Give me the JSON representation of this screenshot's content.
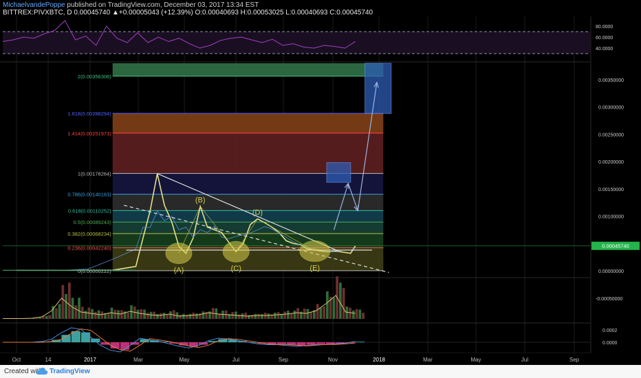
{
  "header": {
    "author": "MichaelvandePoppe",
    "published": "published on TradingView.com, December 03, 2017 13:34 EST",
    "ohlc_line": "BITTREX:PIVXBTC, D  0.00045740  ▲+0.00005043 (+12.39%)  O:0.00040693  H:0.00053025  L:0.00040693  C:0.00045740"
  },
  "footer": {
    "created_with": "Created with",
    "brand": "TradingView"
  },
  "colors": {
    "background": "#000000",
    "candle_up": "#e6e08a",
    "rsi": "#a040c0",
    "trendline": "#dddddd",
    "wave_ellipse": "#d8cc4a",
    "projection_box": "#2c5db5",
    "arrow": "#9fb4e0",
    "price_tag": "#23b54a"
  },
  "chart_data": {
    "type": "line",
    "title": "",
    "symbol": "BITTREX:PIVXBTC",
    "interval": "D",
    "x_tick_labels": [
      "Oct",
      "14",
      "2017",
      "Mar",
      "May",
      "Jul",
      "Sep",
      "Nov",
      "2018",
      "Mar",
      "May",
      "Jul",
      "Sep"
    ],
    "price_axis": {
      "tick_labels": [
        "0.00350000",
        "0.00300000",
        "0.00250000",
        "0.00200000",
        "0.00150000",
        "0.00100000",
        "0.00000000"
      ],
      "tick_values": [
        0.0035,
        0.003,
        0.0025,
        0.002,
        0.0015,
        0.001,
        0.0
      ],
      "last_price_label": "0.00045740",
      "last_price": 0.0004574,
      "ylim": [
        -0.0001,
        0.0038
      ]
    },
    "price_series": {
      "name": "",
      "months": [
        0,
        1,
        2,
        3,
        4,
        5,
        5.3,
        5.6,
        5.9,
        6.2,
        6.5,
        6.8,
        7.1,
        7.4,
        7.7,
        8.0,
        8.3,
        8.6,
        8.9,
        9.2,
        9.5,
        9.8,
        10.1,
        10.4,
        10.7,
        11.0,
        11.3,
        11.6,
        11.9,
        12.2,
        12.5,
        12.8,
        13.1,
        13.4,
        13.7,
        14.0,
        14.2
      ],
      "values": [
        1e-05,
        1e-05,
        1e-05,
        1e-05,
        1e-05,
        8e-05,
        0.0006,
        0.0011,
        0.00178,
        0.0012,
        0.0009,
        0.00045,
        0.00032,
        0.0006,
        0.00118,
        0.0008,
        0.00075,
        0.0007,
        0.00052,
        0.00035,
        0.0005,
        0.00085,
        0.00095,
        0.00088,
        0.0008,
        0.0007,
        0.00055,
        0.0005,
        0.00048,
        0.0004,
        0.00038,
        0.00036,
        0.00035,
        0.00036,
        0.00034,
        0.00032,
        0.000457
      ]
    },
    "fibonacci_levels": [
      {
        "ratio": "2",
        "label": "2(0.00356306)",
        "value": 0.00356306,
        "color": "#3fbf7f",
        "fill": "#2e6b45"
      },
      {
        "ratio": "1.618",
        "label": "1.618(0.00288294)",
        "value": 0.00288294,
        "color": "#5060ff",
        "fill": "#7a3d17"
      },
      {
        "ratio": "1.414",
        "label": "1.414(0.00251973)",
        "value": 0.00251973,
        "color": "#ff4040",
        "fill": "#5a1d20"
      },
      {
        "ratio": "1",
        "label": "1(0.00178264)",
        "value": 0.00178264,
        "color": "#bbbbbb",
        "fill": "#15153d"
      },
      {
        "ratio": "0.786",
        "label": "0.786(0.00140163)",
        "value": 0.00140163,
        "color": "#3aa0e0",
        "fill": "#2b2b2b"
      },
      {
        "ratio": "0.618",
        "label": "0.618(0.00110252)",
        "value": 0.00110252,
        "color": "#2fbf9f",
        "fill": "#123d4d"
      },
      {
        "ratio": "0.5",
        "label": "0.5(0.00089243)",
        "value": 0.00089243,
        "color": "#4caf50",
        "fill": "#153f35"
      },
      {
        "ratio": "0.382",
        "label": "0.382(0.00068234)",
        "value": 0.00068234,
        "color": "#b8c040",
        "fill": "#163d1c"
      },
      {
        "ratio": "0.236",
        "label": "0.236(0.00042240)",
        "value": 0.0004224,
        "color": "#ff5050",
        "fill": "#3a3a14"
      },
      {
        "ratio": "0",
        "label": "0(0.00000222)",
        "value": 2.22e-06,
        "color": "#bbbbbb",
        "fill": "#4a1416"
      }
    ],
    "fib_range_months": [
      5.9,
      15.6
    ],
    "waves": [
      {
        "label": "(A)",
        "month": 6.8,
        "value": 0.00032
      },
      {
        "label": "(B)",
        "month": 7.7,
        "value": 0.00118
      },
      {
        "label": "(C)",
        "month": 9.2,
        "value": 0.00035
      },
      {
        "label": "(D)",
        "month": 10.1,
        "value": 0.00095
      },
      {
        "label": "(E)",
        "month": 12.5,
        "value": 0.00036
      }
    ],
    "trendlines": [
      {
        "from": [
          5.9,
          0.00178
        ],
        "to": [
          13.5,
          0.00036
        ]
      },
      {
        "from": [
          4.5,
          0.0012
        ],
        "to": [
          15.6,
          -3e-05
        ]
      },
      {
        "from": [
          4.6,
          0.00038
        ],
        "to": [
          14.9,
          0.00038
        ]
      }
    ],
    "projection": {
      "boxes": [
        {
          "x0": 13.0,
          "x1": 14.0,
          "y0": 0.00162,
          "y1": 0.00198
        },
        {
          "x0": 14.6,
          "x1": 15.7,
          "y0": 0.00288,
          "y1": 0.0038
        }
      ],
      "path": [
        [
          13.3,
          0.00075
        ],
        [
          13.9,
          0.0016
        ],
        [
          14.3,
          0.0011
        ],
        [
          15.1,
          0.00345
        ]
      ]
    },
    "rsi": {
      "tick_labels": [
        "80.0000",
        "60.0000",
        "40.0000"
      ],
      "tick_values": [
        80,
        60,
        40
      ],
      "bands": [
        70,
        30
      ],
      "values": [
        52,
        55,
        60,
        58,
        66,
        72,
        90,
        55,
        62,
        45,
        80,
        58,
        50,
        68,
        50,
        60,
        52,
        58,
        48,
        40,
        45,
        54,
        58,
        60,
        55,
        50,
        56,
        45,
        48,
        42,
        40,
        45,
        43,
        40,
        52
      ]
    },
    "volume": {
      "tick_labels": [
        "-0.00050000"
      ],
      "values": [
        0.05,
        0.05,
        0.05,
        0.1,
        0.3,
        1.2,
        3.0,
        1.8,
        1.0,
        0.8,
        0.6,
        0.9,
        0.7,
        1.1,
        0.8,
        0.6,
        0.5,
        0.7,
        0.4,
        0.5,
        0.6,
        0.9,
        0.7,
        0.6,
        0.5,
        0.4,
        0.5,
        0.5,
        0.6,
        0.7,
        0.9,
        0.8,
        1.2,
        2.2,
        3.4,
        1.0,
        0.8
      ]
    },
    "macd": {
      "tick_labels": [
        "0.0002",
        "0.0000"
      ],
      "tick_values": [
        0.0002,
        0.0
      ],
      "histogram": [
        0,
        0,
        0,
        0,
        1e-05,
        4e-05,
        0.00012,
        0.00018,
        0.00016,
        6e-05,
        -4e-05,
        -0.0001,
        -0.00012,
        -4e-05,
        5e-05,
        3e-05,
        1e-05,
        -2e-05,
        -5e-05,
        -7e-05,
        -4e-05,
        2e-05,
        5e-05,
        4e-05,
        2e-05,
        0.0,
        -2e-05,
        -3e-05,
        -3e-05,
        -4e-05,
        -5e-05,
        -4e-05,
        -3e-05,
        -3e-05,
        -2e-05,
        -1e-05,
        1e-05
      ]
    }
  }
}
